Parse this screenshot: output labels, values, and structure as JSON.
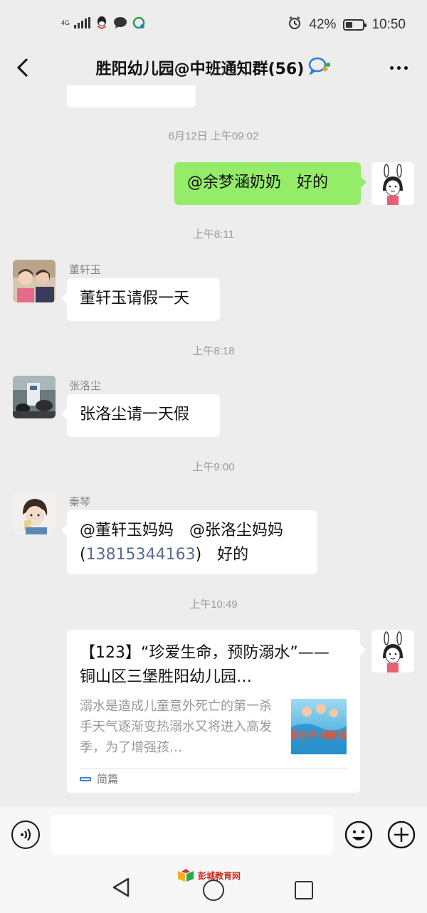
{
  "status_bar": {
    "network": "4G",
    "battery": "42%",
    "battery_level": 0.42,
    "time": "10:50"
  },
  "header": {
    "title": "胜阳幼儿园@中班通知群(56)"
  },
  "messages": {
    "t1": "6月12日 上午09:02",
    "m1": {
      "text": "@余梦涵奶奶　好的"
    },
    "t2": "上午8:11",
    "m2": {
      "sender": "董轩玉",
      "text": "董轩玉请假一天"
    },
    "t3": "上午8:18",
    "m3": {
      "sender": "张洛尘",
      "text": "张洛尘请一天假"
    },
    "t4": "上午9:00",
    "m4": {
      "sender": "秦琴",
      "line1": "@董轩玉妈妈　@张洛尘妈妈",
      "paren_open": "(",
      "phone": "13815344163",
      "paren_close": ")",
      "tail": "　好的"
    },
    "t5": "上午10:49",
    "m5": {
      "title": "【123】“珍爱生命，预防溺水”——铜山区三堡胜阳幼儿园…",
      "desc": "溺水是造成儿童意外死亡的第一杀手天气逐渐变热溺水又将进入高发季，为了增强孩…",
      "thumb_text": "珍爱生命 预防溺水",
      "source": "简篇"
    }
  },
  "input": {
    "value": "",
    "placeholder": ""
  },
  "watermark": "彭城教育网"
}
